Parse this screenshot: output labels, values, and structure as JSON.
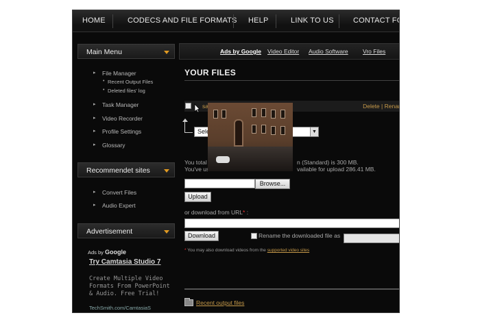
{
  "nav": {
    "items": [
      "HOME",
      "CODECS AND FILE FORMATS",
      "HELP",
      "LINK TO US",
      "CONTACT FO"
    ]
  },
  "sidebar": {
    "main_menu": {
      "title": "Main Menu",
      "items": [
        "File Manager",
        "Task Manager",
        "Video Recorder",
        "Profile Settings",
        "Glossary"
      ],
      "subitems": [
        "Recent Output Files",
        "Deleted files' log"
      ]
    },
    "recommended": {
      "title": "Recommendet sites",
      "items": [
        "Convert Files",
        "Audio Expert"
      ]
    },
    "advertisement": {
      "title": "Advertisement",
      "ads_by": "Ads by",
      "ads_brand": "Google",
      "ad_title": "Try Camtasia Studio 7",
      "ad_body": "Create Multiple Video Formats From PowerPoint & Audio. Free Trial!",
      "ad_url": "TechSmith.com/CamtasiaS"
    }
  },
  "ads_bar": {
    "label": "Ads by Google",
    "links": [
      "Video Editor",
      "Audio Software",
      "Vro Files"
    ]
  },
  "main": {
    "heading": "YOUR FILES",
    "row_actions": "Delete | Renam",
    "row_prefix": "sa",
    "select_value": "Sele",
    "info_line1_left": "You total",
    "info_line1_right": "n (Standard) is 300 MB.",
    "info_line2_left": "You've us",
    "info_line2_right": "vailable for upload 286.41 MB.",
    "browse_label": "Browse...",
    "upload_label": "Upload",
    "or_download_label": "or download from URL",
    "or_download_suffix": " :",
    "download_label": "Download",
    "rename_label": "Rename the downloaded file as",
    "note_text": "You may also download videos from the",
    "note_link": "supported video sites",
    "recent_link": "Recent output files"
  },
  "colors": {
    "accent": "#e09a22",
    "link": "#c79a4a",
    "background": "#0a0a0a"
  }
}
